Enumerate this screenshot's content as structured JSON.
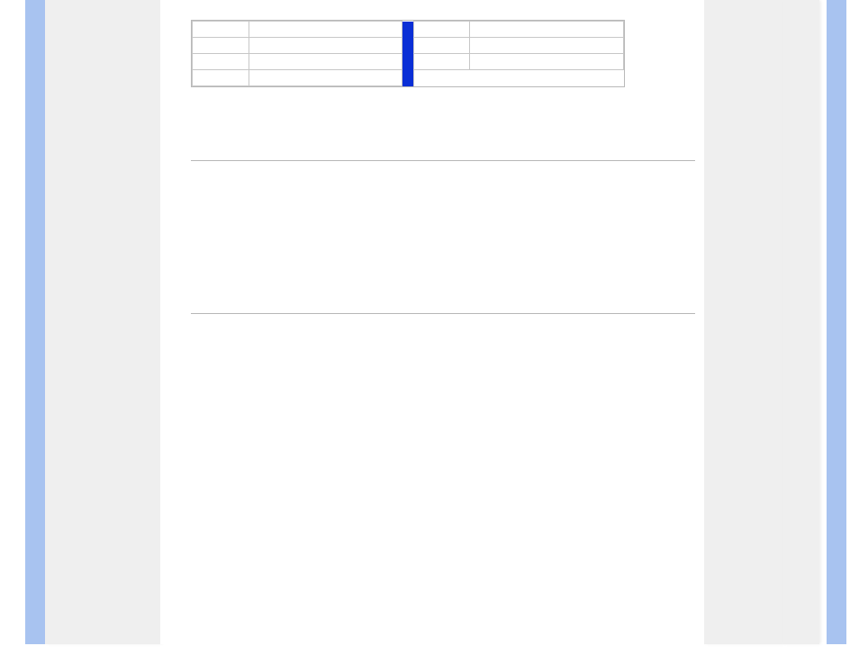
{
  "colors": {
    "outer_blue": "#a8c3f0",
    "sidebar_gray": "#efefef",
    "divider_blue": "#0a2fd6",
    "rule_gray": "#b7b7b7",
    "cell_border": "#c7c7c7"
  },
  "info_table": {
    "row1": {
      "left_label": "",
      "left_value": "",
      "right_label": "",
      "right_value": ""
    },
    "row2": {
      "left_label": "",
      "left_value": "",
      "right_label": "",
      "right_value": ""
    },
    "row3": {
      "left_label": "",
      "left_value": "",
      "right_label": "",
      "right_value": ""
    },
    "row4": {
      "left_label": "",
      "left_value": ""
    }
  }
}
